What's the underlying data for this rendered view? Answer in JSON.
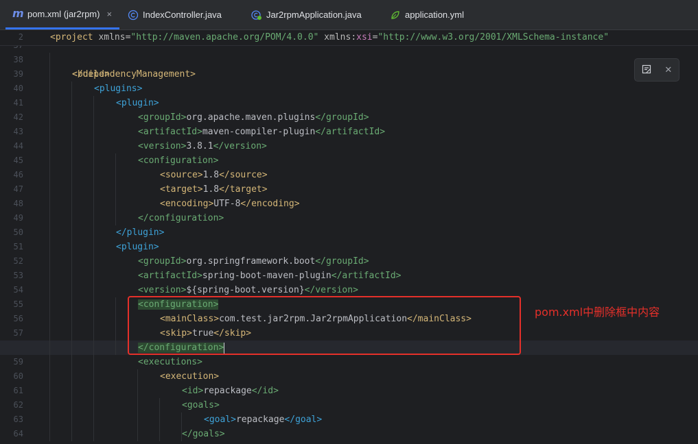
{
  "tabs": [
    {
      "label": "pom.xml (jar2rpm)",
      "icon": "maven-m-icon",
      "active": true,
      "close": "×"
    },
    {
      "label": "IndexController.java",
      "icon": "java-class-icon"
    },
    {
      "label": "Jar2rpmApplication.java",
      "icon": "spring-boot-class-icon"
    },
    {
      "label": "application.yml",
      "icon": "spring-leaf-icon"
    }
  ],
  "sticky": {
    "line_number": "2",
    "open": "<project",
    "attr1": " xmlns=",
    "val1": "\"http://maven.apache.org/POM/4.0.0\"",
    "attr2_ns": " xmlns",
    "attr2_colon": ":",
    "attr2_name": "xsi",
    "attr2_eq": "=",
    "val2": "\"http://www.w3.org/2001/XMLSchema-instance\""
  },
  "hidden_line": {
    "line_number": "37",
    "text": "</dependencyManagement>"
  },
  "lines": [
    {
      "n": "38",
      "indent": 0,
      "parts": []
    },
    {
      "n": "39",
      "indent": 1,
      "parts": [
        {
          "t": "<build>",
          "c": "tag"
        }
      ]
    },
    {
      "n": "40",
      "indent": 2,
      "parts": [
        {
          "t": "<plugins>",
          "c": "tagb"
        }
      ]
    },
    {
      "n": "41",
      "indent": 3,
      "parts": [
        {
          "t": "<plugin>",
          "c": "tagb"
        }
      ]
    },
    {
      "n": "42",
      "indent": 4,
      "parts": [
        {
          "t": "<groupId>",
          "c": "str"
        },
        {
          "t": "org.apache.maven.plugins",
          "c": "txt"
        },
        {
          "t": "</groupId>",
          "c": "str"
        }
      ]
    },
    {
      "n": "43",
      "indent": 4,
      "parts": [
        {
          "t": "<artifactId>",
          "c": "str"
        },
        {
          "t": "maven-compiler-plugin",
          "c": "txt"
        },
        {
          "t": "</artifactId>",
          "c": "str"
        }
      ]
    },
    {
      "n": "44",
      "indent": 4,
      "parts": [
        {
          "t": "<version>",
          "c": "str"
        },
        {
          "t": "3.8.1",
          "c": "txt"
        },
        {
          "t": "</version>",
          "c": "str"
        }
      ]
    },
    {
      "n": "45",
      "indent": 4,
      "parts": [
        {
          "t": "<configuration>",
          "c": "str"
        }
      ]
    },
    {
      "n": "46",
      "indent": 5,
      "parts": [
        {
          "t": "<source>",
          "c": "tag"
        },
        {
          "t": "1.8",
          "c": "txt"
        },
        {
          "t": "</source>",
          "c": "tag"
        }
      ]
    },
    {
      "n": "47",
      "indent": 5,
      "parts": [
        {
          "t": "<target>",
          "c": "tag"
        },
        {
          "t": "1.8",
          "c": "txt"
        },
        {
          "t": "</target>",
          "c": "tag"
        }
      ]
    },
    {
      "n": "48",
      "indent": 5,
      "parts": [
        {
          "t": "<encoding>",
          "c": "tag"
        },
        {
          "t": "UTF-8",
          "c": "txt"
        },
        {
          "t": "</encoding>",
          "c": "tag"
        }
      ]
    },
    {
      "n": "49",
      "indent": 4,
      "parts": [
        {
          "t": "</configuration>",
          "c": "str"
        }
      ]
    },
    {
      "n": "50",
      "indent": 3,
      "parts": [
        {
          "t": "</plugin>",
          "c": "tagb"
        }
      ]
    },
    {
      "n": "51",
      "indent": 3,
      "parts": [
        {
          "t": "<plugin>",
          "c": "tagb"
        }
      ]
    },
    {
      "n": "52",
      "indent": 4,
      "parts": [
        {
          "t": "<groupId>",
          "c": "str"
        },
        {
          "t": "org.springframework.boot",
          "c": "txt"
        },
        {
          "t": "</groupId>",
          "c": "str"
        }
      ]
    },
    {
      "n": "53",
      "indent": 4,
      "parts": [
        {
          "t": "<artifactId>",
          "c": "str"
        },
        {
          "t": "spring-boot-maven-plugin",
          "c": "txt"
        },
        {
          "t": "</artifactId>",
          "c": "str"
        }
      ]
    },
    {
      "n": "54",
      "indent": 4,
      "parts": [
        {
          "t": "<version>",
          "c": "str"
        },
        {
          "t": "${spring-boot.version}",
          "c": "txt"
        },
        {
          "t": "</version>",
          "c": "str"
        }
      ]
    },
    {
      "n": "55",
      "indent": 4,
      "parts": [
        {
          "t": "<configuration>",
          "c": "tagsel"
        }
      ]
    },
    {
      "n": "56",
      "indent": 5,
      "parts": [
        {
          "t": "<mainClass>",
          "c": "tag"
        },
        {
          "t": "com.test.jar2rpm.Jar2rpmApplication",
          "c": "txt"
        },
        {
          "t": "</mainClass>",
          "c": "tag"
        }
      ]
    },
    {
      "n": "57",
      "indent": 5,
      "parts": [
        {
          "t": "<skip>",
          "c": "tag"
        },
        {
          "t": "true",
          "c": "txt"
        },
        {
          "t": "</skip>",
          "c": "tag"
        }
      ]
    },
    {
      "n": "58",
      "indent": 4,
      "current": true,
      "parts": [
        {
          "t": "</configuration>",
          "c": "tagsel"
        }
      ]
    },
    {
      "n": "59",
      "indent": 4,
      "parts": [
        {
          "t": "<executions>",
          "c": "str"
        }
      ]
    },
    {
      "n": "60",
      "indent": 5,
      "parts": [
        {
          "t": "<execution>",
          "c": "tag"
        }
      ]
    },
    {
      "n": "61",
      "indent": 6,
      "parts": [
        {
          "t": "<id>",
          "c": "str"
        },
        {
          "t": "repackage",
          "c": "txt"
        },
        {
          "t": "</id>",
          "c": "str"
        }
      ]
    },
    {
      "n": "62",
      "indent": 6,
      "parts": [
        {
          "t": "<goals>",
          "c": "str"
        }
      ]
    },
    {
      "n": "63",
      "indent": 7,
      "parts": [
        {
          "t": "<goal>",
          "c": "tagb"
        },
        {
          "t": "repackage",
          "c": "txt"
        },
        {
          "t": "</goal>",
          "c": "tagb"
        }
      ]
    },
    {
      "n": "64",
      "indent": 6,
      "parts": [
        {
          "t": "</goals>",
          "c": "str"
        }
      ]
    }
  ],
  "annotation": {
    "text": "pom.xml中删除框中内容"
  },
  "colors": {
    "annotation_red": "#e5302a",
    "tab_accent": "#3574f0"
  }
}
